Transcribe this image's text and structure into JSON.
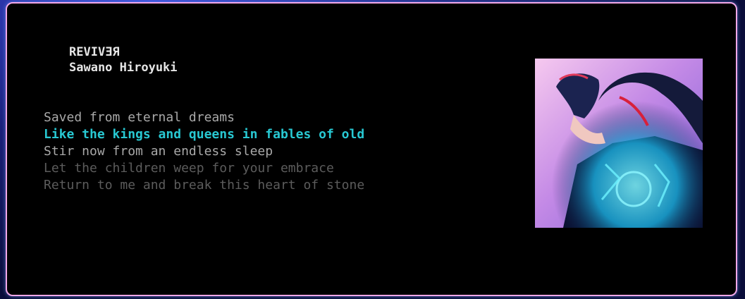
{
  "track": {
    "title": "REVIVƎЯ",
    "artist": "Sawano Hiroyuki"
  },
  "lyrics": [
    {
      "text": "Saved from eternal dreams",
      "state": "past",
      "color": "#a9a9a9"
    },
    {
      "text": "Like the kings and queens in fables of old",
      "state": "current",
      "color": "#28c8d2"
    },
    {
      "text": "Stir now from an endless sleep",
      "state": "next",
      "color": "#a9a9a9"
    },
    {
      "text": "Let the children weep for your embrace",
      "state": "upcoming",
      "color": "#5c5c5c"
    },
    {
      "text": "Return to me and break this heart of stone",
      "state": "upcoming",
      "color": "#5c5c5c"
    }
  ],
  "colors": {
    "border": "#f2a7e8",
    "background": "#000000",
    "accent": "#28c8d2"
  }
}
